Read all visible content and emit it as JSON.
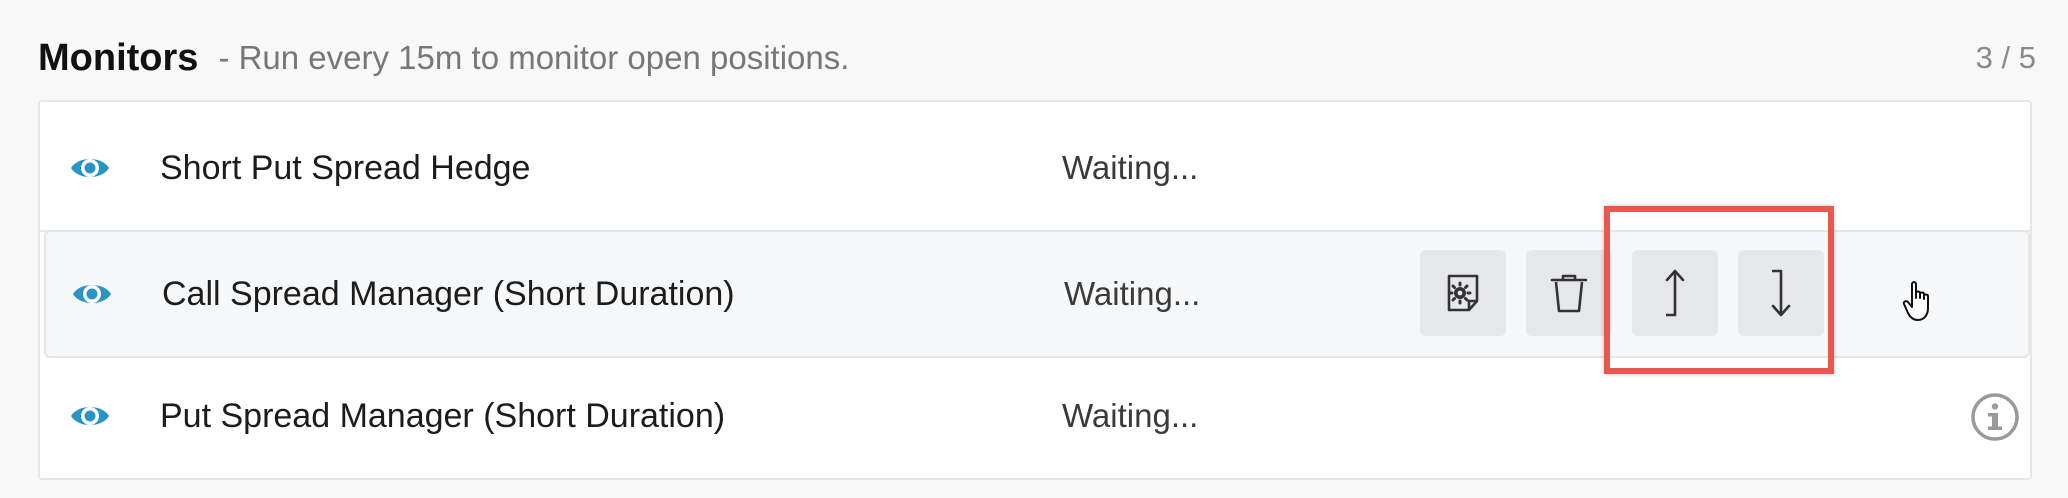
{
  "header": {
    "title": "Monitors",
    "subtitle": "- Run every 15m to monitor open positions.",
    "counter": "3 / 5"
  },
  "monitors": [
    {
      "name": "Short Put Spread Hedge",
      "status": "Waiting...",
      "icon": "eye-icon"
    },
    {
      "name": "Call Spread Manager (Short Duration)",
      "status": "Waiting...",
      "icon": "eye-icon"
    },
    {
      "name": "Put Spread Manager (Short Duration)",
      "status": "Waiting...",
      "icon": "eye-icon"
    }
  ],
  "row_actions": [
    {
      "icon": "settings-document-icon"
    },
    {
      "icon": "trash-icon"
    },
    {
      "icon": "move-up-icon"
    },
    {
      "icon": "move-down-icon"
    }
  ],
  "colors": {
    "accent": "#2a95c5",
    "highlight": "#e8584f",
    "button_bg": "#e6e7ea"
  }
}
